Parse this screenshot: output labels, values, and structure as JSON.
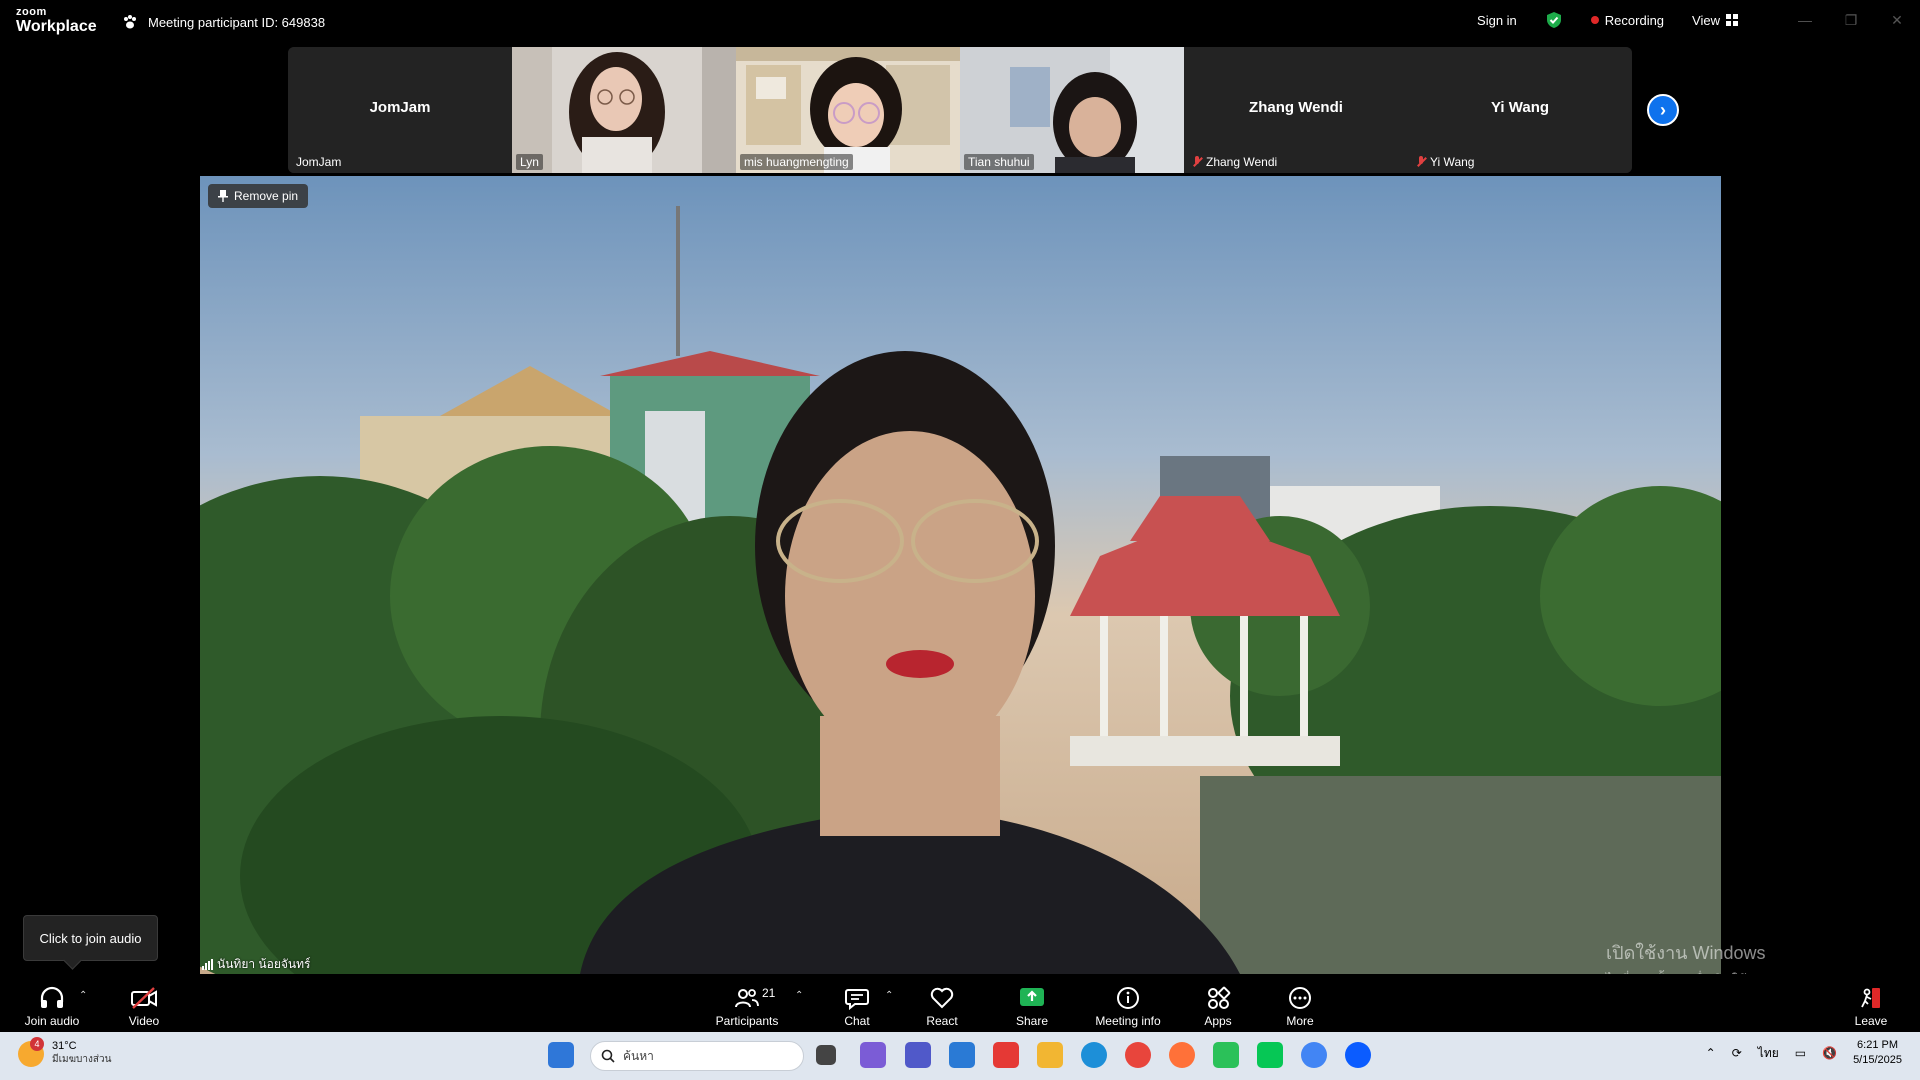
{
  "titlebar": {
    "logo_small": "zoom",
    "logo_big": "Workplace",
    "meeting_id": "Meeting participant ID: 649838",
    "sign_in": "Sign in",
    "recording": "Recording",
    "view": "View"
  },
  "gallery": {
    "tiles": [
      {
        "display": "JomJam",
        "label": "JomJam",
        "muted": false
      },
      {
        "label": "Lyn"
      },
      {
        "label": "mis huangmengting"
      },
      {
        "label": "Tian shuhui"
      },
      {
        "display": "Zhang Wendi",
        "label": "Zhang Wendi",
        "muted": true
      },
      {
        "display": "Yi Wang",
        "label": "Yi Wang",
        "muted": true
      }
    ]
  },
  "main": {
    "remove_pin": "Remove pin",
    "speaker_name": "นันทิยา น้อยจันทร์",
    "activate_line1": "เปิดใช้งาน Windows",
    "activate_line2": "ไปที่ การตั้งค่า เพื่อเปิดใช้งาน Windows"
  },
  "tooltip": {
    "text": "Click to join audio"
  },
  "toolbar": {
    "join_audio": "Join audio",
    "video": "Video",
    "participants": "Participants",
    "participant_count": "21",
    "chat": "Chat",
    "react": "React",
    "share": "Share",
    "meeting_info": "Meeting info",
    "apps": "Apps",
    "more": "More",
    "leave": "Leave"
  },
  "taskbar": {
    "weather_temp": "31°C",
    "weather_desc": "มีเมฆบางส่วน",
    "weather_badge": "4",
    "search_placeholder": "ค้นหา",
    "language": "ไทย",
    "time": "6:21 PM",
    "date": "5/15/2025"
  },
  "colors": {
    "accent": "#0e72ed",
    "share_green": "#1fb355",
    "record_red": "#e02828",
    "shield_green": "#1dab4a"
  }
}
